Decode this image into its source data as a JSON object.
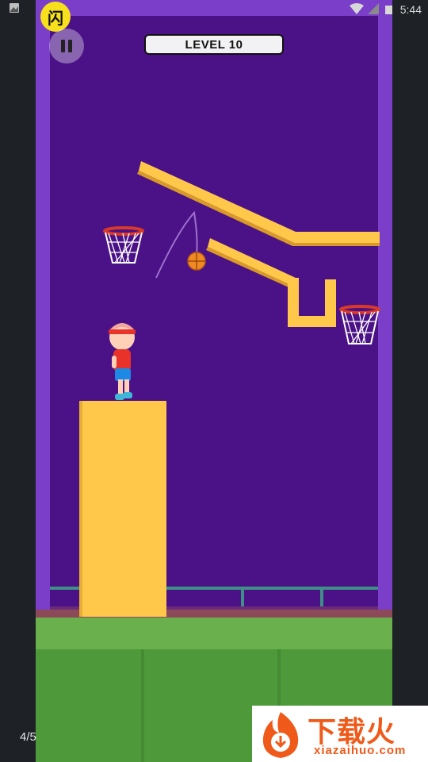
{
  "status_bar": {
    "time": "5:44",
    "icons": [
      "image-icon",
      "wifi-icon",
      "signal-icon",
      "battery-icon"
    ]
  },
  "app_badge": {
    "glyph": "闪"
  },
  "hud": {
    "level_label": "LEVEL 10",
    "pause_icon": "pause-icon"
  },
  "scene": {
    "elements": [
      "player",
      "basketball",
      "hoop-left",
      "hoop-right",
      "pedestal",
      "ramp-upper",
      "ramp-lower",
      "u-bucket",
      "trajectory"
    ]
  },
  "colors": {
    "background": "#4b1187",
    "wall": "#7a3ec9",
    "platform": "#ffc84a",
    "grass": "#6ab04c",
    "hoop_rim": "#d83a2a",
    "ball": "#f08a24"
  },
  "page_indicator": "4/5",
  "watermark": {
    "title": "下载火",
    "subtitle": "xiazaihuo.com"
  }
}
